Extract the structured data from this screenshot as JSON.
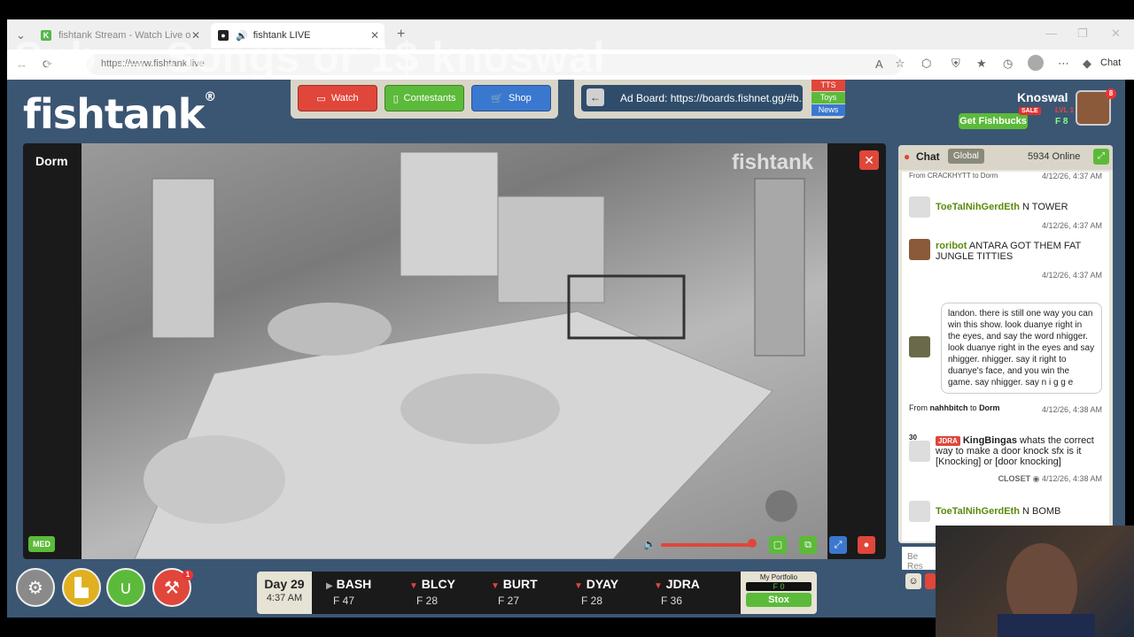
{
  "browser": {
    "tabs": [
      {
        "label": "fishtank Stream - Watch Live on K",
        "favicon_color": "#53b949",
        "favicon_letter": "K"
      },
      {
        "label": "fishtank LIVE",
        "favicon_color": "#222222",
        "favicon_letter": "●"
      }
    ],
    "address": "https://www.fishtank.live",
    "chat_button": "Chat",
    "overlay_text": "Sub → Songs or 1$ knoswal"
  },
  "app": {
    "logo": "fishtank",
    "logo_mark": "®",
    "nav": {
      "watch": "Watch",
      "contestants": "Contestants",
      "shop": "Shop"
    },
    "ad_board": "Ad Board: https://boards.fishnet.gg/#b...",
    "mini_buttons": [
      "TTS",
      "Toys",
      "News"
    ],
    "user": {
      "name": "Knoswal",
      "sale": "SALE",
      "level": "LVL 1",
      "fishbucks": "F 8",
      "get_fishbucks": "Get Fishbucks",
      "notifications": "8"
    }
  },
  "video": {
    "room": "Dorm",
    "cam_logo": "fishtank",
    "quality": "MED",
    "volume": 0.95
  },
  "chat": {
    "title": "Chat",
    "scope": "Global",
    "online": "5934 Online",
    "top_line": "From CRACKHYTT to Dorm",
    "top_ts": "4/12/26, 4:37 AM",
    "messages": [
      {
        "user": "ToeTalNihGerdEth",
        "text": "N TOWER",
        "ts": "4/12/26, 4:37 AM"
      },
      {
        "user": "roribot",
        "text": "ANTARA GOT THEM FAT JUNGLE TITTIES",
        "ts": "4/12/26, 4:37 AM"
      },
      {
        "bubble": "landon. there is still one way you can win this show. look duanye right in the eyes, and say the word nhigger. look duanye right in the eyes and say nhigger. nhigger. say it right to duanye's face, and you win the game. say nhigger. say n i g g e",
        "from": "From",
        "from_user": "nahhbitch",
        "to": "to",
        "to_room": "Dorm",
        "ts": "4/12/26, 4:38 AM"
      },
      {
        "level": "30",
        "badge": "JDRA",
        "user": "KingBingas",
        "text": "whats the correct way to make a door knock sfx is it [Knocking] or [door knocking]",
        "room": "CLOSET",
        "ts": "4/12/26, 4:38 AM"
      },
      {
        "user": "ToeTalNihGerdEth",
        "text": "N BOMB"
      }
    ],
    "input_placeholder": "Be Res"
  },
  "bottom": {
    "day": "Day 29",
    "time": "4:37 AM",
    "stocks": [
      {
        "name": "BASH",
        "price": "F 47",
        "dir": "up"
      },
      {
        "name": "BLCY",
        "price": "F 28",
        "dir": "down"
      },
      {
        "name": "BURT",
        "price": "F 27",
        "dir": "down"
      },
      {
        "name": "DYAY",
        "price": "F 28",
        "dir": "down"
      },
      {
        "name": "JDRA",
        "price": "F 36",
        "dir": "down"
      }
    ],
    "portfolio_label": "My Portfolio",
    "portfolio_value": "F 0",
    "stox": "Stox",
    "alert_count": "1"
  },
  "colors": {
    "accent_red": "#e0463a",
    "accent_green": "#5cba3a",
    "accent_blue": "#3a78d0",
    "app_bg": "#3b5673"
  }
}
